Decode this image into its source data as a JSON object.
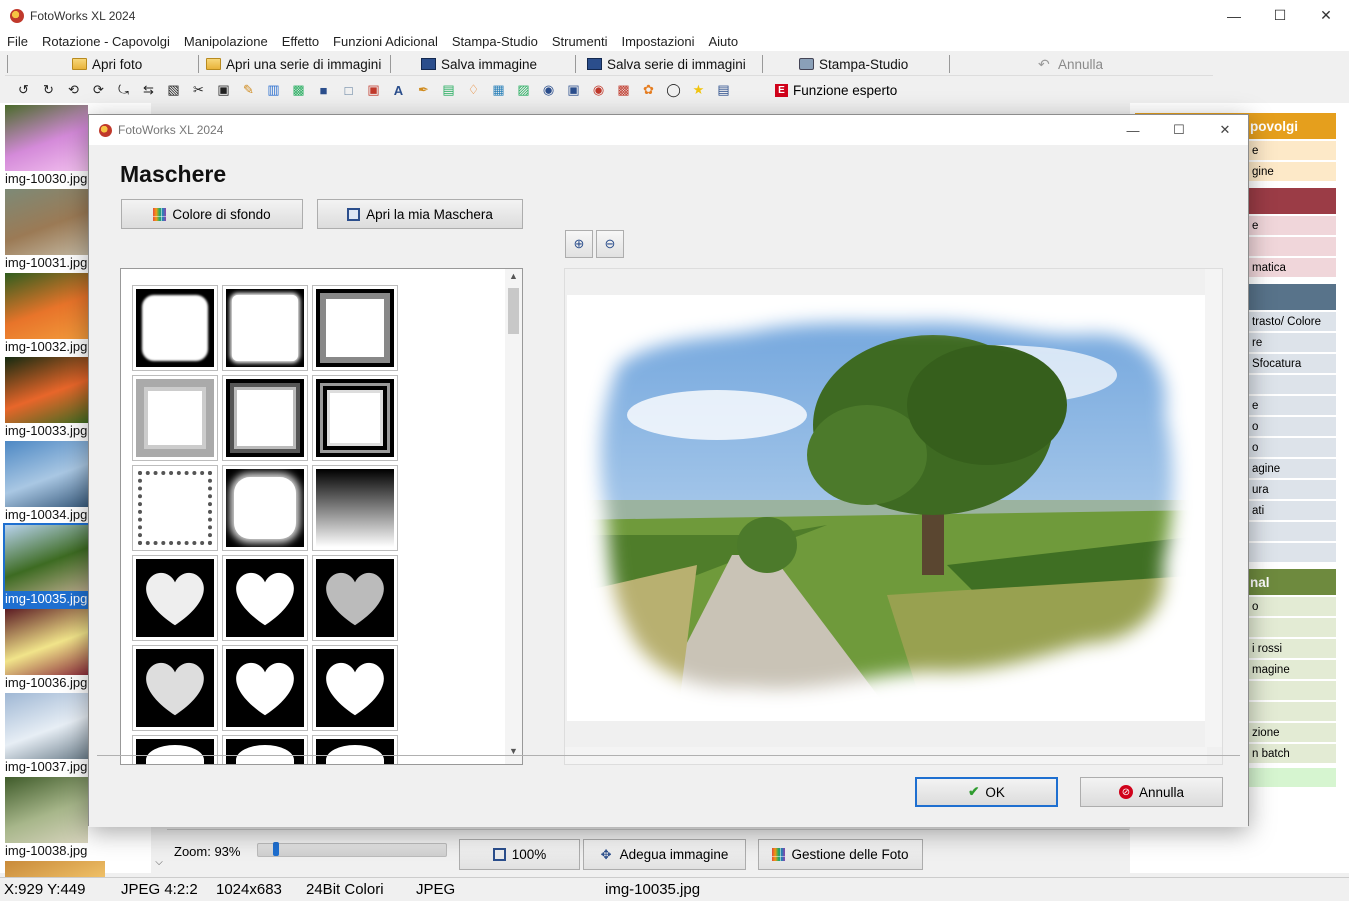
{
  "app": {
    "title": "FotoWorks XL 2024"
  },
  "menu": [
    "File",
    "Rotazione - Capovolgi",
    "Manipolazione",
    "Effetto",
    "Funzioni Adicional",
    "Stampa-Studio",
    "Strumenti",
    "Impostazioni",
    "Aiuto"
  ],
  "toolbar": {
    "open_photo": "Apri foto",
    "open_series": "Apri una serie di immagini",
    "save_image": "Salva immagine",
    "save_series": "Salva serie di immagini",
    "print_studio": "Stampa-Studio",
    "undo": "Annulla",
    "expert_mode": "Funzione esperto",
    "expert_badge": "E"
  },
  "thumbnails": [
    {
      "name": "img-10030.jpg",
      "colors": [
        "#4a6b2a",
        "#d48ad9",
        "#f3c1ef"
      ]
    },
    {
      "name": "img-10031.jpg",
      "colors": [
        "#7d8a77",
        "#9b7a55",
        "#c3b8a2"
      ]
    },
    {
      "name": "img-10032.jpg",
      "colors": [
        "#2f5d1e",
        "#e8742a",
        "#f29b3b"
      ]
    },
    {
      "name": "img-10033.jpg",
      "colors": [
        "#142a10",
        "#e8662a",
        "#3d6b22"
      ]
    },
    {
      "name": "img-10034.jpg",
      "colors": [
        "#4d88c4",
        "#a9c7e3",
        "#385a7c"
      ]
    },
    {
      "name": "img-10035.jpg",
      "colors": [
        "#b9d3ee",
        "#3d6b22",
        "#b8a98a"
      ],
      "selected": true
    },
    {
      "name": "img-10036.jpg",
      "colors": [
        "#5b1b23",
        "#f1e48a",
        "#8a2b3a"
      ]
    },
    {
      "name": "img-10037.jpg",
      "colors": [
        "#9fb7d4",
        "#e7eef5",
        "#6d7f8c"
      ]
    },
    {
      "name": "img-10038.jpg",
      "colors": [
        "#3f5b2a",
        "#a7b68a",
        "#d8d4be"
      ]
    },
    {
      "name": "",
      "colors": [
        "#c88a3a",
        "#f2c46a",
        "#6d4a22"
      ]
    }
  ],
  "right_panel": {
    "sections": [
      {
        "header": "povolgi",
        "color": "#e59f1d",
        "bg": "#fde9c8",
        "items": [
          "e",
          "gine"
        ]
      },
      {
        "header": "",
        "color": "#9b3c46",
        "bg": "#f0d6da",
        "items": [
          "e",
          "",
          "matica"
        ]
      },
      {
        "header": "",
        "color": "#58738a",
        "bg": "#dde3ea",
        "items": [
          "trasto/ Colore",
          "re",
          "Sfocatura",
          "",
          "e",
          "o",
          "o",
          "agine",
          "ura",
          "ati",
          "",
          ""
        ]
      },
      {
        "header": "nal",
        "color": "#6e8a3e",
        "bg": "#e3ebd4",
        "items": [
          "o",
          "",
          "i rossi",
          "magine",
          "",
          "",
          "zione",
          "n batch"
        ]
      }
    ],
    "tail_color": "#d6f5d0"
  },
  "zoombar": {
    "zoom_label": "Zoom: 93%",
    "zoom_fraction": 0.08,
    "btn_100": "100%",
    "btn_fit": "Adegua immagine",
    "btn_manage": "Gestione delle Foto"
  },
  "status": {
    "coords": "X:929 Y:449",
    "format": "JPEG  4:2:2",
    "size": "1024x683",
    "colors": "24Bit Colori",
    "type": "JPEG",
    "file": "img-10035.jpg"
  },
  "dialog": {
    "title": "FotoWorks XL 2024",
    "heading": "Maschere",
    "btn_bg_color": "Colore di sfondo",
    "btn_open_mask": "Apri la mia Maschera",
    "ok": "OK",
    "cancel": "Annulla",
    "masks": [
      {
        "kind": "rough"
      },
      {
        "kind": "rough-soft"
      },
      {
        "kind": "frame-thick"
      },
      {
        "kind": "frame-soft"
      },
      {
        "kind": "frame-bevel"
      },
      {
        "kind": "frame-double"
      },
      {
        "kind": "frame-leaves"
      },
      {
        "kind": "rough-cloud"
      },
      {
        "kind": "gradient"
      },
      {
        "kind": "heart-mosaic"
      },
      {
        "kind": "heart-smooth"
      },
      {
        "kind": "heart-pebble"
      },
      {
        "kind": "heart-pebble-2"
      },
      {
        "kind": "heart-rough"
      },
      {
        "kind": "heart-solid"
      },
      {
        "kind": "partial-1"
      },
      {
        "kind": "partial-2"
      },
      {
        "kind": "partial-3"
      }
    ]
  }
}
